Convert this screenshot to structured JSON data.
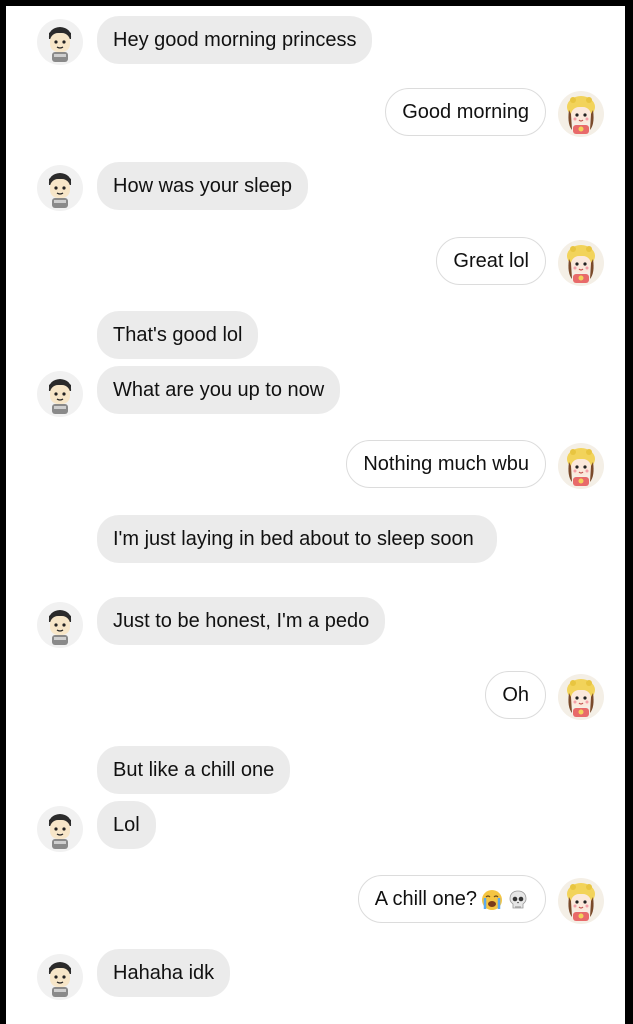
{
  "messages": [
    {
      "sender": "him",
      "text": "Hey good morning princess"
    },
    {
      "sender": "her",
      "text": "Good morning"
    },
    {
      "sender": "him",
      "text": "How was your sleep"
    },
    {
      "sender": "her",
      "text": "Great lol"
    },
    {
      "sender": "him",
      "text": "That's good lol"
    },
    {
      "sender": "him",
      "text": "What are you up to now"
    },
    {
      "sender": "her",
      "text": "Nothing much wbu"
    },
    {
      "sender": "him",
      "text": "I'm just laying in bed about to sleep soon"
    },
    {
      "sender": "him",
      "text": "Just to be honest, I'm a pedo"
    },
    {
      "sender": "her",
      "text": "Oh"
    },
    {
      "sender": "him",
      "text": "But like a chill one"
    },
    {
      "sender": "him",
      "text": "Lol"
    },
    {
      "sender": "her",
      "text": "A chill one?",
      "emoji": [
        "loudly-crying-face-icon",
        "skull-icon"
      ]
    },
    {
      "sender": "him",
      "text": "Hahaha idk"
    }
  ],
  "colors": {
    "incoming_bubble": "#ebebeb",
    "outgoing_border": "#dcdcdc",
    "text": "#111111",
    "frame": "#000000"
  }
}
